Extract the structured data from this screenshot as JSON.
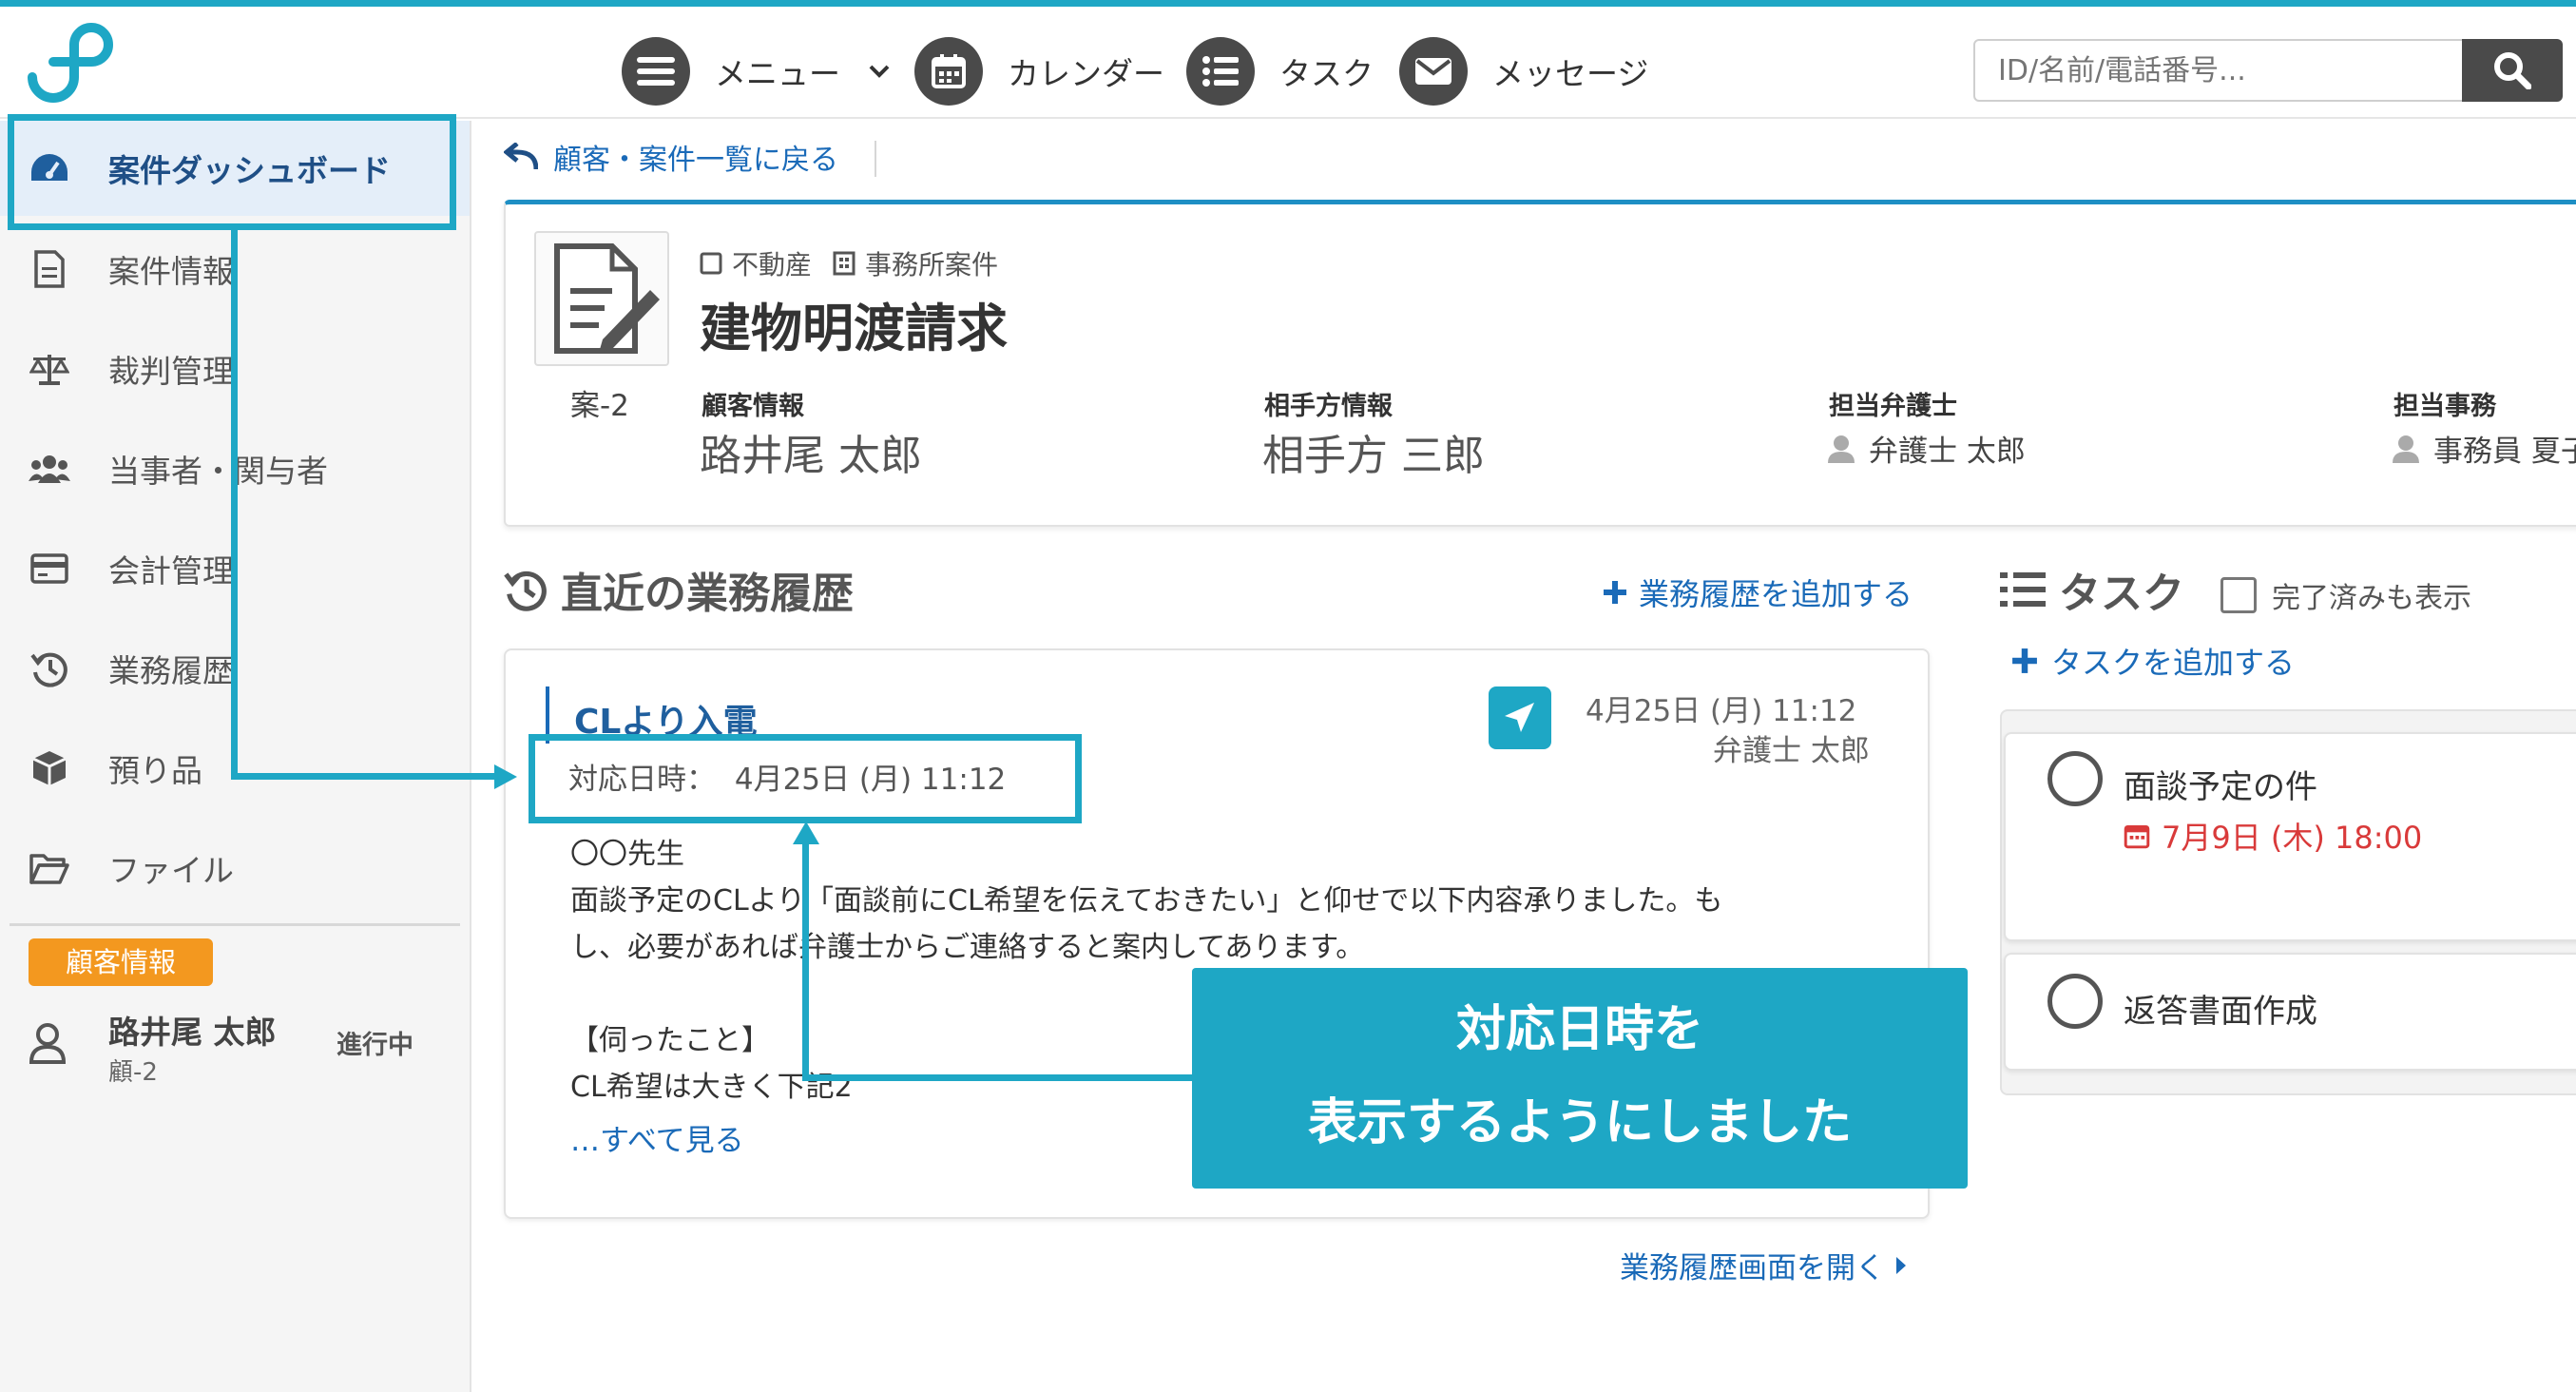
{
  "nav": {
    "menu": "メニュー",
    "calendar": "カレンダー",
    "task": "タスク",
    "message": "メッセージ",
    "search_placeholder": "ID/名前/電話番号..."
  },
  "sidebar": {
    "items": [
      {
        "label": "案件ダッシュボード",
        "icon": "dashboard-icon"
      },
      {
        "label": "案件情報",
        "icon": "document-icon"
      },
      {
        "label": "裁判管理",
        "icon": "scale-icon"
      },
      {
        "label": "当事者・関与者",
        "icon": "users-icon"
      },
      {
        "label": "会計管理",
        "icon": "credit-card-icon"
      },
      {
        "label": "業務履歴",
        "icon": "history-icon"
      },
      {
        "label": "預り品",
        "icon": "box-icon"
      },
      {
        "label": "ファイル",
        "icon": "folder-icon"
      }
    ],
    "client_badge": "顧客情報",
    "client_name": "路井尾 太郎",
    "client_id": "顧-2",
    "client_status": "進行中"
  },
  "breadcrumb": "顧客・案件一覧に戻る",
  "case": {
    "tag_category": "不動産",
    "tag_office": "事務所案件",
    "title": "建物明渡請求",
    "id": "案-2",
    "client_label": "顧客情報",
    "client_value": "路井尾 太郎",
    "opponent_label": "相手方情報",
    "opponent_value": "相手方 三郎",
    "lawyer_label": "担当弁護士",
    "lawyer_value": "弁護士 太郎",
    "staff_label": "担当事務",
    "staff_value": "事務員 夏子"
  },
  "history": {
    "title": "直近の業務履歴",
    "add_link": "業務履歴を追加する",
    "entry_title": "CLより入電",
    "entry_datetime_label": "対応日時：",
    "entry_datetime": "4月25日 (月) 11:12",
    "entry_date": "4月25日 (月) 11:12",
    "entry_author": "弁護士 太郎",
    "body_line1": "〇〇先生",
    "body_line2": "面談予定のCLより「面談前にCL希望を伝えておきたい」と仰せで以下内容承りました。も",
    "body_line3": "し、必要があれば弁護士からご連絡すると案内してあります。",
    "body_line4": "【伺ったこと】",
    "body_line5": "CL希望は大きく下記2",
    "see_all": "…すべて見る",
    "open_link": "業務履歴画面を開く"
  },
  "tasks": {
    "title": "タスク",
    "show_done": "完了済みも表示",
    "add_link": "タスクを追加する",
    "items": [
      {
        "title": "面談予定の件",
        "due": "7月9日 (木) 18:00"
      },
      {
        "title": "返答書面作成"
      }
    ]
  },
  "callout": {
    "line1": "対応日時を",
    "line2": "表示するようにしました"
  },
  "colors": {
    "accent": "#1ea7c5",
    "link": "#1a6ab8",
    "dark_icon": "#4a4a4a",
    "badge": "#f3981f",
    "due_red": "#d93a3a"
  }
}
